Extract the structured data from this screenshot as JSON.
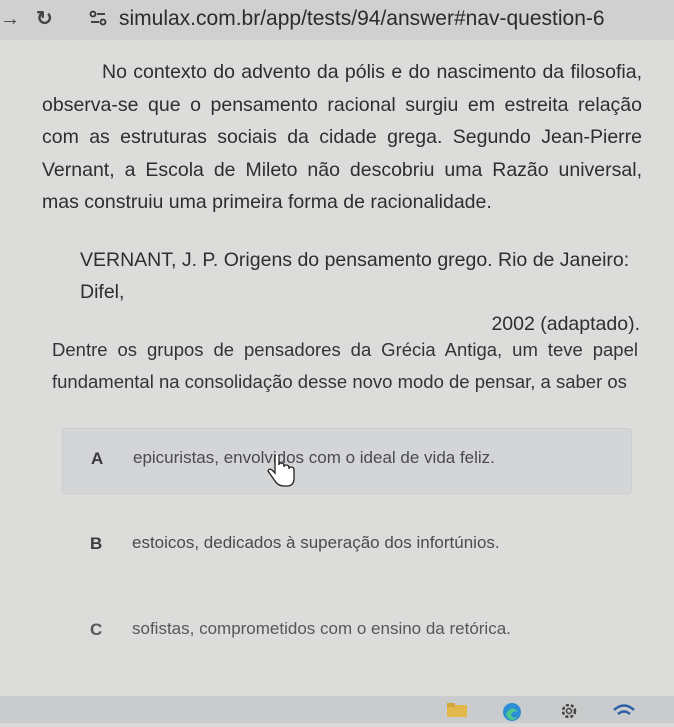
{
  "browser": {
    "forward_icon": "arrow-right-icon",
    "reload_icon": "reload-icon",
    "site_settings_icon": "tune-icon",
    "url": "simulax.com.br/app/tests/94/answer#nav-question-6"
  },
  "question": {
    "context_paragraph": "No contexto do advento da pólis e do nascimento da filosofia, observa-se que o pensamento racional surgiu em estreita relação com as estruturas sociais da cidade grega. Segundo Jean-Pierre Vernant, a Escola de Mileto não descobriu uma Razão universal, mas construiu uma primeira forma de racionalidade.",
    "reference_line1": "VERNANT, J. P. Origens do pensamento grego. Rio de Janeiro: Difel,",
    "reference_line2": "2002 (adaptado).",
    "prompt": "Dentre os grupos de pensadores da Grécia Antiga, um teve papel fundamental na consolidação desse novo modo de pensar, a saber os",
    "options": [
      {
        "letter": "A",
        "text": "epicuristas, envolvidos com o ideal de vida feliz."
      },
      {
        "letter": "B",
        "text": "estoicos, dedicados à superação dos infortúnios."
      },
      {
        "letter": "C",
        "text": "sofistas, comprometidos com o ensino da retórica."
      }
    ]
  },
  "taskbar": {
    "icons": [
      "folder-icon",
      "edge-icon",
      "settings-icon",
      "wifi-icon"
    ]
  },
  "colors": {
    "background": "#dcdcdb",
    "text": "#2d2e32",
    "option_hover": "#d4d5d6"
  }
}
